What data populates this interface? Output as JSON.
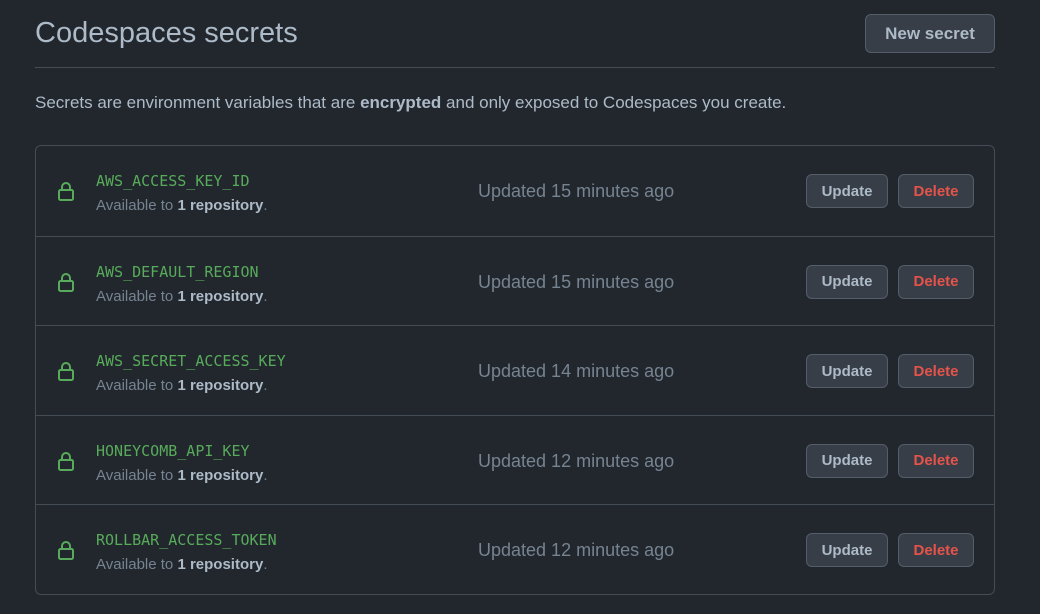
{
  "header": {
    "title": "Codespaces secrets",
    "new_secret_label": "New secret"
  },
  "description": {
    "before": "Secrets are environment variables that are ",
    "emphasis": "encrypted",
    "after": " and only exposed to Codespaces you create."
  },
  "secrets": [
    {
      "name": "AWS_ACCESS_KEY_ID",
      "avail_prefix": "Available to ",
      "avail_count": "1 repository",
      "avail_suffix": ".",
      "updated": "Updated 15 minutes ago",
      "update_label": "Update",
      "delete_label": "Delete"
    },
    {
      "name": "AWS_DEFAULT_REGION",
      "avail_prefix": "Available to ",
      "avail_count": "1 repository",
      "avail_suffix": ".",
      "updated": "Updated 15 minutes ago",
      "update_label": "Update",
      "delete_label": "Delete"
    },
    {
      "name": "AWS_SECRET_ACCESS_KEY",
      "avail_prefix": "Available to ",
      "avail_count": "1 repository",
      "avail_suffix": ".",
      "updated": "Updated 14 minutes ago",
      "update_label": "Update",
      "delete_label": "Delete"
    },
    {
      "name": "HONEYCOMB_API_KEY",
      "avail_prefix": "Available to ",
      "avail_count": "1 repository",
      "avail_suffix": ".",
      "updated": "Updated 12 minutes ago",
      "update_label": "Update",
      "delete_label": "Delete"
    },
    {
      "name": "ROLLBAR_ACCESS_TOKEN",
      "avail_prefix": "Available to ",
      "avail_count": "1 repository",
      "avail_suffix": ".",
      "updated": "Updated 12 minutes ago",
      "update_label": "Update",
      "delete_label": "Delete"
    }
  ],
  "icons": {
    "secret": "lock-icon"
  },
  "colors": {
    "background": "#22272e",
    "border": "#444c56",
    "secret_name": "#57ab5a",
    "delete": "#e5534b",
    "muted_text": "#768390",
    "text": "#adbac7",
    "button_bg": "#373e47"
  }
}
